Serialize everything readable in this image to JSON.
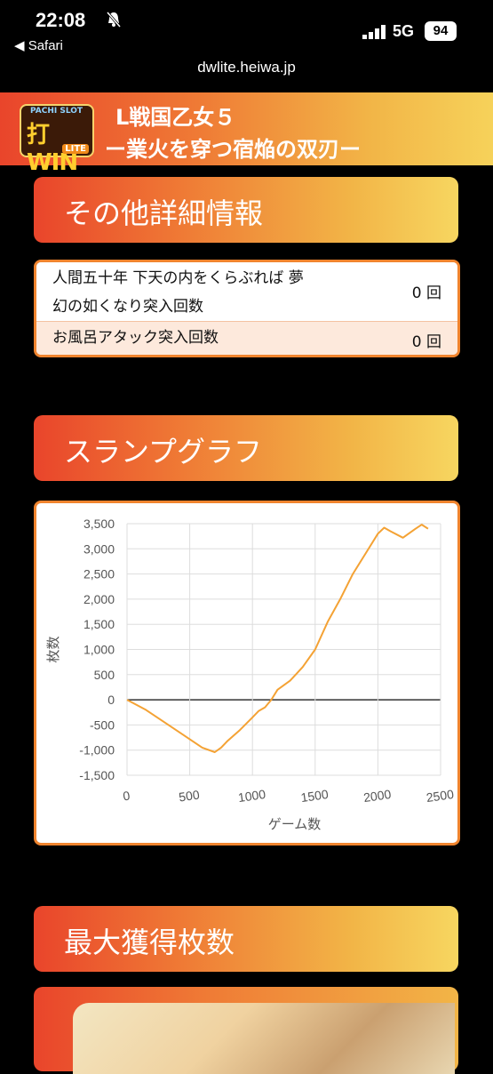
{
  "status": {
    "time": "22:08",
    "back_label": "◀ Safari",
    "network": "5G",
    "battery": "94"
  },
  "browser": {
    "url": "dwlite.heiwa.jp"
  },
  "header": {
    "logo_text": "打WIN",
    "logo_sub": "LITE",
    "logo_top": "PACHI SLOT",
    "title_line1": "L戦国乙女５",
    "title_line2": "ー業火を穿つ宿焔の双刃ー"
  },
  "sections": {
    "other_info": "その他詳細情報",
    "slump_graph": "スランプグラフ",
    "max_gain": "最大獲得枚数"
  },
  "info_table": [
    {
      "label": "人間五十年 下天の内をくらぶれば 夢幻の如くなり突入回数",
      "value": "0 回"
    },
    {
      "label": "お風呂アタック突入回数",
      "value": "0 回"
    }
  ],
  "chart_data": {
    "type": "line",
    "xlabel": "ゲーム数",
    "ylabel": "枚数",
    "xlim": [
      0,
      2500
    ],
    "ylim": [
      -1500,
      3500
    ],
    "x_ticks": [
      "0",
      "500",
      "1000",
      "1500",
      "2000",
      "2500"
    ],
    "y_ticks": [
      "3,500",
      "3,000",
      "2,500",
      "2,000",
      "1,500",
      "1,000",
      "500",
      "0",
      "-500",
      "-1,000",
      "-1,500"
    ],
    "grid": true,
    "line_color": "#f4a234",
    "series": [
      {
        "x": [
          0,
          150,
          300,
          450,
          600,
          700,
          750,
          800,
          900,
          1000,
          1050,
          1100,
          1150,
          1200,
          1300,
          1400,
          1500,
          1600,
          1700,
          1800,
          1900,
          2000,
          2050,
          2100,
          2200,
          2300,
          2350,
          2400
        ],
        "y": [
          0,
          -200,
          -450,
          -700,
          -950,
          -1040,
          -950,
          -820,
          -600,
          -350,
          -220,
          -150,
          0,
          200,
          380,
          650,
          1000,
          1550,
          2000,
          2500,
          2900,
          3300,
          3420,
          3350,
          3220,
          3400,
          3480,
          3400
        ]
      }
    ]
  }
}
